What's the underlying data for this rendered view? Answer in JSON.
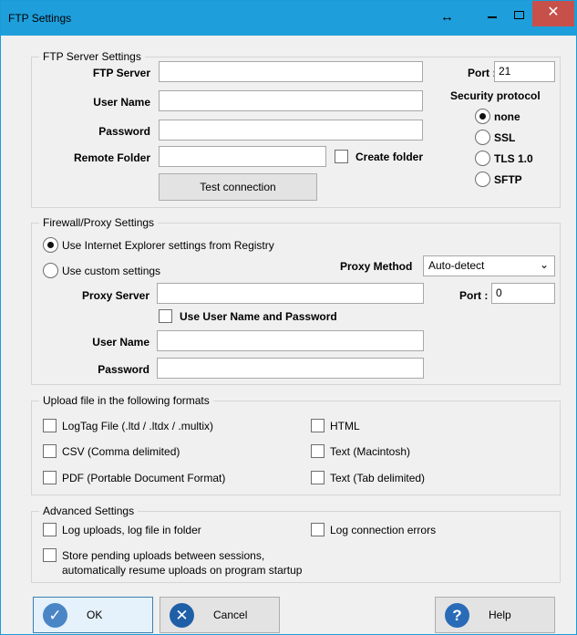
{
  "window": {
    "title": "FTP Settings"
  },
  "ftp": {
    "group_title": "FTP Server Settings",
    "server_label": "FTP Server",
    "server_value": "",
    "user_label": "User Name",
    "user_value": "",
    "password_label": "Password",
    "password_value": "",
    "remote_folder_label": "Remote Folder",
    "remote_folder_value": "",
    "create_folder_label": "Create folder",
    "test_connection_label": "Test connection",
    "port_label": "Port :",
    "port_value": "21",
    "security_protocol_label": "Security protocol",
    "protocols": [
      {
        "label": "none",
        "selected": true
      },
      {
        "label": "SSL",
        "selected": false
      },
      {
        "label": "TLS 1.0",
        "selected": false
      },
      {
        "label": "SFTP",
        "selected": false
      }
    ]
  },
  "firewall": {
    "group_title": "Firewall/Proxy Settings",
    "use_ie_label": "Use Internet Explorer settings from Registry",
    "use_custom_label": "Use custom settings",
    "proxy_method_label": "Proxy Method",
    "proxy_method_value": "Auto-detect",
    "proxy_server_label": "Proxy Server",
    "proxy_server_value": "",
    "port_label": "Port :",
    "port_value": "0",
    "use_credentials_label": "Use User Name and Password",
    "user_label": "User Name",
    "user_value": "",
    "password_label": "Password",
    "password_value": ""
  },
  "upload": {
    "group_title": "Upload file in the following formats",
    "logtag_label": "LogTag File (.ltd / .ltdx / .multix)",
    "csv_label": "CSV (Comma delimited)",
    "pdf_label": "PDF (Portable Document Format)",
    "html_label": "HTML",
    "text_mac_label": "Text (Macintosh)",
    "text_tab_label": "Text (Tab delimited)"
  },
  "advanced": {
    "group_title": "Advanced Settings",
    "log_uploads_label": "Log uploads, log file in folder",
    "log_errors_label": "Log connection errors",
    "store_pending_line1": "Store pending uploads between sessions,",
    "store_pending_line2": "automatically resume uploads on program startup"
  },
  "buttons": {
    "ok": "OK",
    "cancel": "Cancel",
    "help": "Help"
  },
  "colors": {
    "titlebar": "#1e9fdb",
    "close_button": "#c7504a",
    "icon_blue": "#4a86c5"
  }
}
